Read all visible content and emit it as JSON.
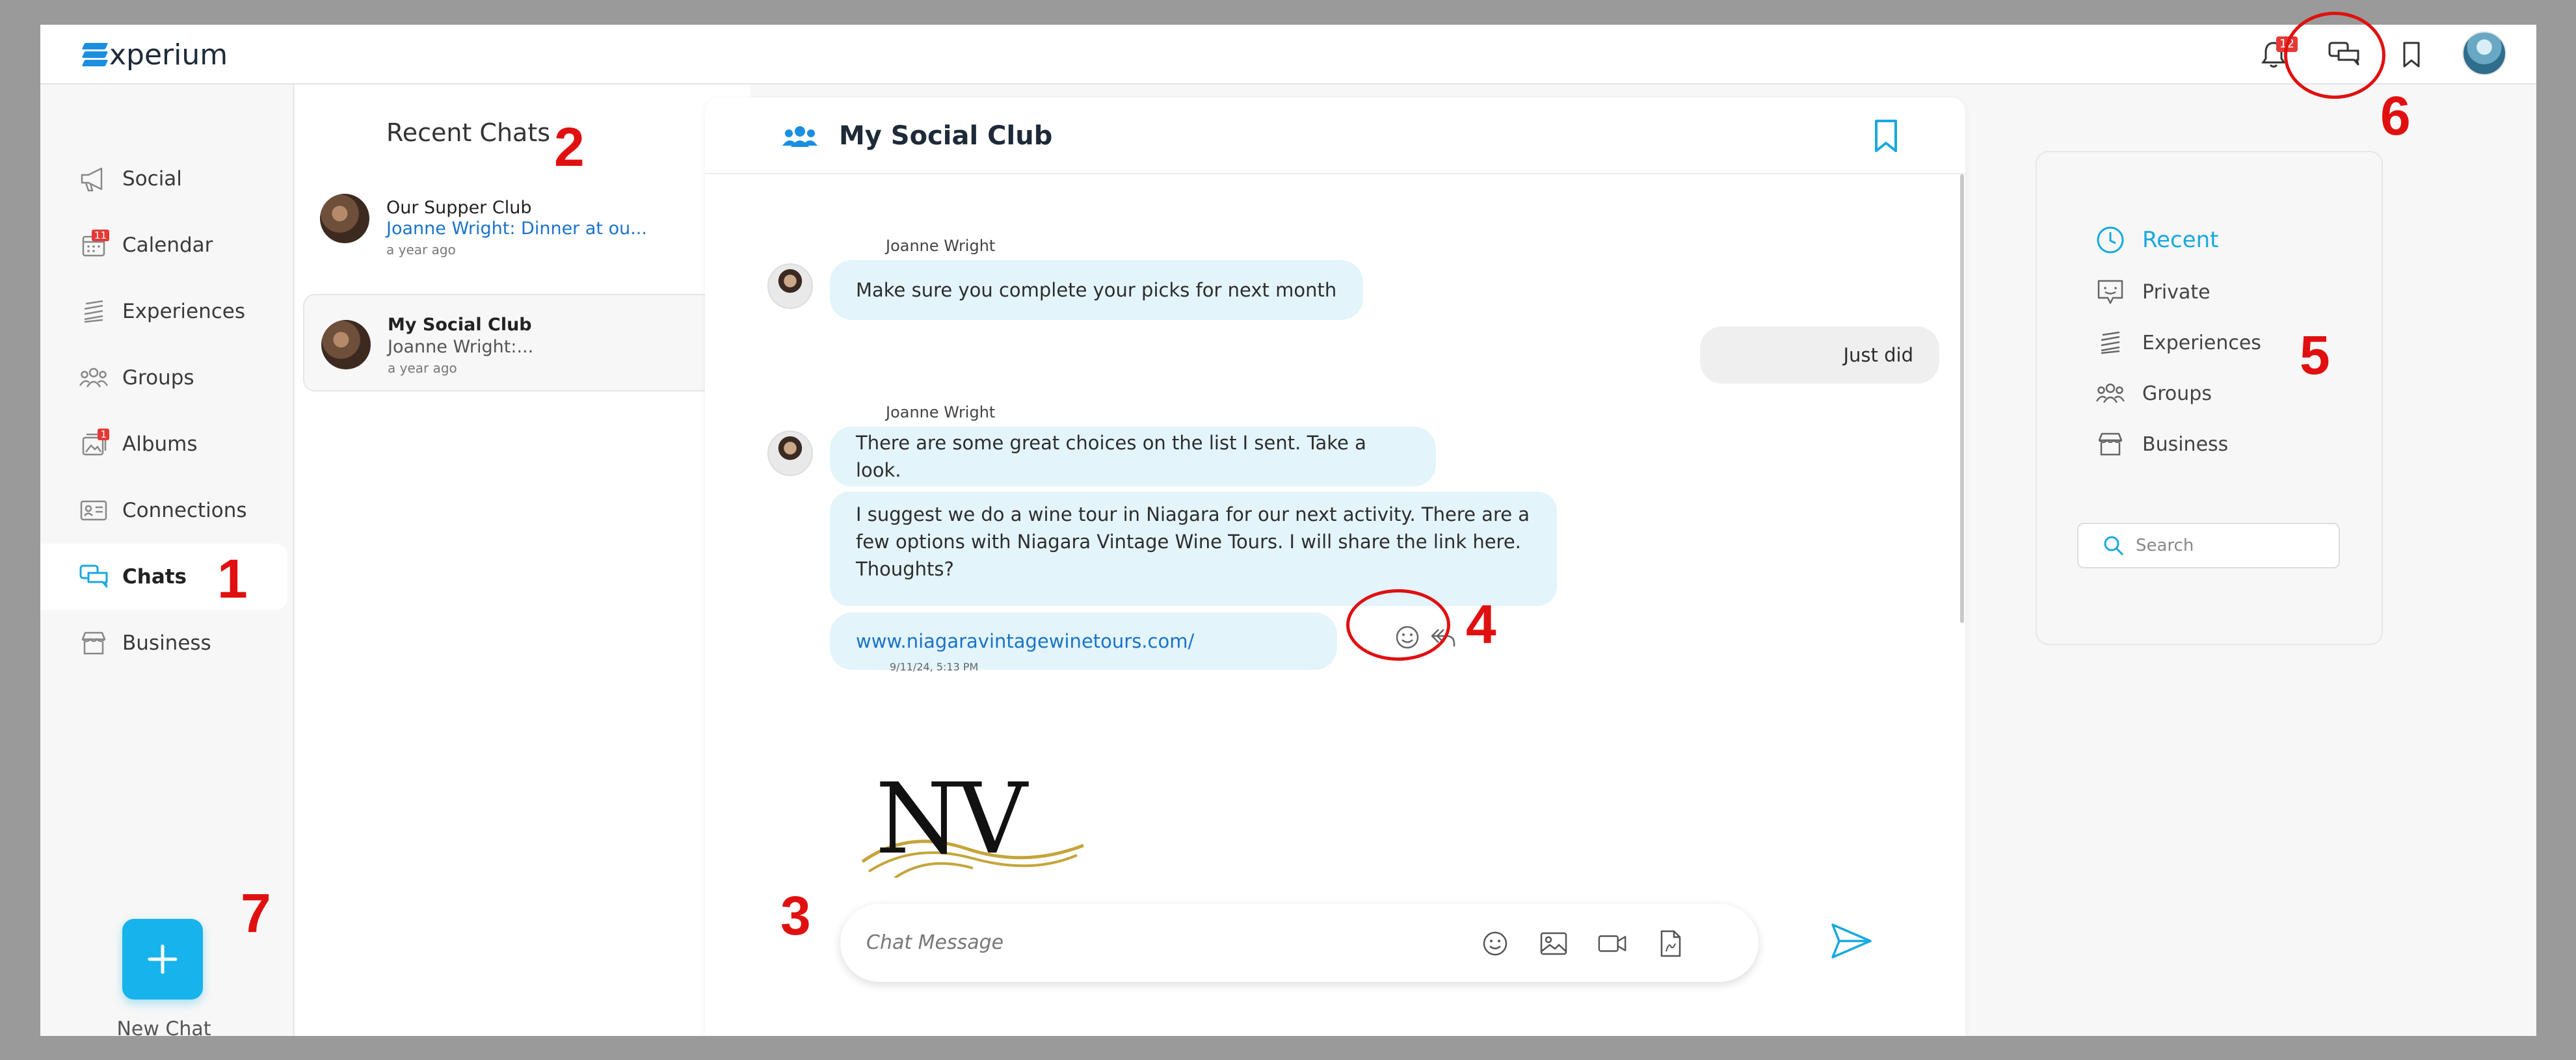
{
  "app": {
    "logo_text": "xperium",
    "brand_color": "#17b3ec"
  },
  "topbar": {
    "notification_count": "12",
    "icons": [
      "bell-icon",
      "chat-icon",
      "bookmark-icon",
      "user-avatar"
    ]
  },
  "nav": {
    "items": [
      {
        "label": "Social",
        "icon": "megaphone-icon"
      },
      {
        "label": "Calendar",
        "icon": "calendar-icon",
        "badge": "11"
      },
      {
        "label": "Experiences",
        "icon": "experiences-icon"
      },
      {
        "label": "Groups",
        "icon": "groups-icon"
      },
      {
        "label": "Albums",
        "icon": "albums-icon",
        "badge": "1"
      },
      {
        "label": "Connections",
        "icon": "contact-card-icon"
      },
      {
        "label": "Chats",
        "icon": "chat-icon",
        "active": true
      },
      {
        "label": "Business",
        "icon": "store-icon"
      }
    ],
    "new_chat_label": "New Chat"
  },
  "recent": {
    "title": "Recent Chats",
    "chats": [
      {
        "name": "Our Supper Club",
        "preview": "Joanne Wright: Dinner at ou...",
        "time": "a year ago"
      },
      {
        "name": "My Social Club",
        "preview": "Joanne Wright:...",
        "time": "a year ago",
        "selected": true
      }
    ]
  },
  "chat": {
    "title": "My Social Club",
    "messages": [
      {
        "sender": "Joanne Wright",
        "text": "Make sure you complete your picks for next month"
      },
      {
        "text": "Just did",
        "outgoing": true
      },
      {
        "sender": "Joanne Wright",
        "text": "There are some great choices on the list I sent. Take a look."
      },
      {
        "text_lines": [
          "I suggest we do a wine tour in Niagara for our next activity. There are a",
          "few options with Niagara Vintage Wine Tours. I will share the link here.",
          "Thoughts?"
        ]
      },
      {
        "link": "www.niagaravintagewinetours.com/",
        "timestamp": "9/11/24, 5:13 PM"
      }
    ],
    "preview_logo_text": "NV",
    "composer_placeholder": "Chat Message"
  },
  "filter": {
    "items": [
      {
        "label": "Recent",
        "icon": "clock-icon",
        "active": true
      },
      {
        "label": "Private",
        "icon": "private-chat-icon"
      },
      {
        "label": "Experiences",
        "icon": "experiences-icon"
      },
      {
        "label": "Groups",
        "icon": "groups-icon"
      },
      {
        "label": "Business",
        "icon": "store-icon"
      }
    ],
    "search_placeholder": "Search"
  },
  "annotations": [
    "1",
    "2",
    "3",
    "4",
    "5",
    "6",
    "7"
  ]
}
